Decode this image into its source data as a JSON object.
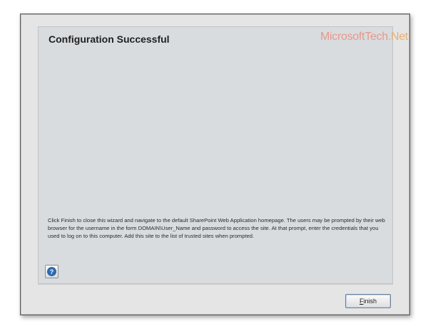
{
  "dialog": {
    "title": "Configuration Successful",
    "description": "Click Finish to close this wizard and navigate to the default SharePoint Web Application homepage. The users may be prompted by their web browser for the username in the form DOMAIN\\User_Name and password to access the site. At that prompt, enter the credentials that you used to log on to this computer. Add this site to the list of trusted sites when prompted.",
    "help_icon": "question-mark-icon"
  },
  "watermark": {
    "part1": "MicrosoftTech",
    "part2": ".Net"
  },
  "footer": {
    "finish_access_key": "F",
    "finish_rest": "inish"
  },
  "colors": {
    "panel": "#d9dcdf",
    "window": "#e5e5e5",
    "help_icon": "#2c6cb4"
  }
}
